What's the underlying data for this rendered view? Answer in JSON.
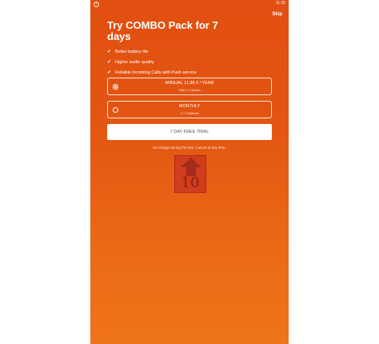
{
  "status_bar": {
    "time": "11:35",
    "app_icon": "app-circle-icon"
  },
  "header": {
    "skip_label": "Skip"
  },
  "promo": {
    "title": "Try COMBO Pack for 7 days",
    "features": [
      {
        "icon": "check-icon",
        "label": "Better battery life"
      },
      {
        "icon": "check-icon",
        "label": "Higher audio quality"
      },
      {
        "icon": "check-icon",
        "label": "Reliable Incoming Calls with Push service"
      }
    ]
  },
  "plans": [
    {
      "title": "ANNUAL 11,99 € / YEAR",
      "subtitle": "ONLY 1 /Month",
      "selected": true
    },
    {
      "title": "MONTHLY",
      "subtitle": "1,??-€/Month",
      "selected": false
    }
  ],
  "cta": {
    "label": "7 DAY FREE TRIAL"
  },
  "disclaimer": "No charge during the trial. Cancel at any time.",
  "overlay_badge": {
    "number": "10",
    "icon": "up-arrow-icon"
  },
  "colors": {
    "background_top": "#e14f10",
    "background_bottom": "#ef7419",
    "button_bg": "#ffffff",
    "button_text": "#555555",
    "badge": "#a42a1c"
  }
}
